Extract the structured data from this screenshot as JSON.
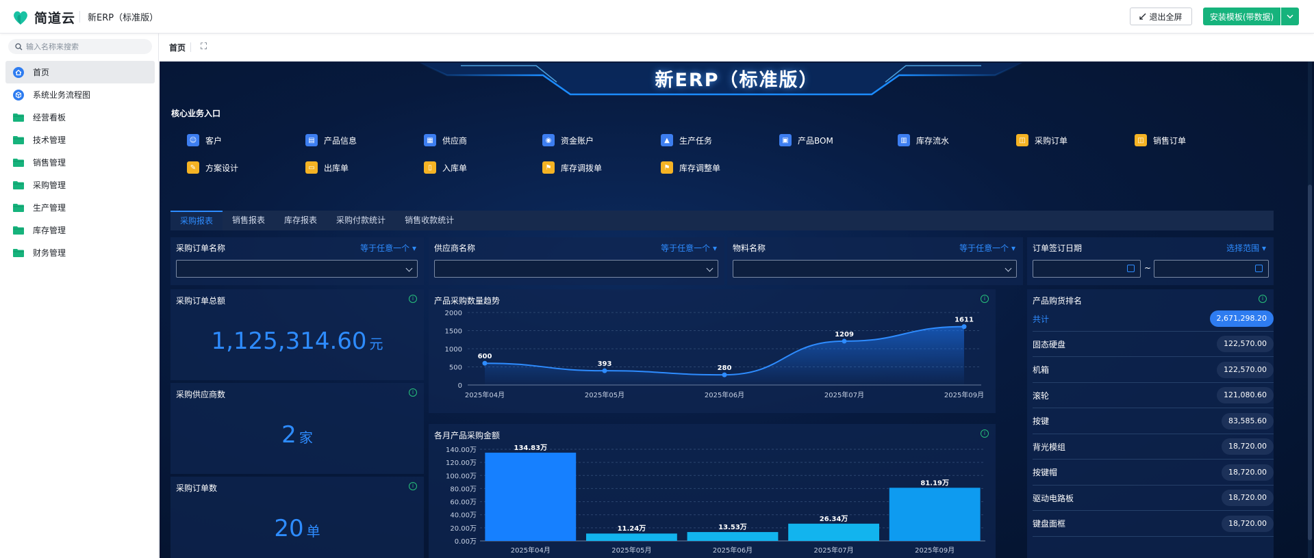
{
  "topbar": {
    "logo_text": "简道云",
    "app_name": "新ERP（标准版）",
    "exit_fullscreen": "退出全屏",
    "install_button": "安装模板(带数据)"
  },
  "sidebar": {
    "search_placeholder": "输入名称来搜索",
    "items": [
      {
        "label": "首页",
        "icon": "home-icon"
      },
      {
        "label": "系统业务流程图",
        "icon": "cube-icon"
      },
      {
        "label": "经营看板",
        "icon": "folder-icon"
      },
      {
        "label": "技术管理",
        "icon": "folder-icon"
      },
      {
        "label": "销售管理",
        "icon": "folder-icon"
      },
      {
        "label": "采购管理",
        "icon": "folder-icon"
      },
      {
        "label": "生产管理",
        "icon": "folder-icon"
      },
      {
        "label": "库存管理",
        "icon": "folder-icon"
      },
      {
        "label": "财务管理",
        "icon": "folder-icon"
      }
    ]
  },
  "tabs": {
    "home": "首页"
  },
  "dashboard": {
    "title": "新ERP（标准版）",
    "entry_section": "核心业务入口",
    "entries": [
      {
        "label": "客户",
        "color": "blue"
      },
      {
        "label": "产品信息",
        "color": "blue"
      },
      {
        "label": "供应商",
        "color": "blue"
      },
      {
        "label": "资金账户",
        "color": "blue"
      },
      {
        "label": "生产任务",
        "color": "blue"
      },
      {
        "label": "产品BOM",
        "color": "blue"
      },
      {
        "label": "库存流水",
        "color": "blue"
      },
      {
        "label": "采购订单",
        "color": "yellow"
      },
      {
        "label": "销售订单",
        "color": "yellow"
      },
      {
        "label": "方案设计",
        "color": "yellow"
      },
      {
        "label": "出库单",
        "color": "yellow"
      },
      {
        "label": "入库单",
        "color": "yellow"
      },
      {
        "label": "库存调拨单",
        "color": "yellow"
      },
      {
        "label": "库存调整单",
        "color": "yellow"
      }
    ],
    "report_tabs": [
      "采购报表",
      "销售报表",
      "库存报表",
      "采购付款统计",
      "销售收款统计"
    ],
    "filters": [
      {
        "label": "采购订单名称",
        "op": "等于任意一个"
      },
      {
        "label": "供应商名称",
        "op": "等于任意一个"
      },
      {
        "label": "物料名称",
        "op": "等于任意一个"
      },
      {
        "label": "订单签订日期",
        "op": "选择范围",
        "range_sep": "~"
      }
    ],
    "kpis": [
      {
        "title": "采购订单总额",
        "value": "1,125,314.60",
        "unit": "元"
      },
      {
        "title": "采购供应商数",
        "value": "2",
        "unit": "家"
      },
      {
        "title": "采购订单数",
        "value": "20",
        "unit": "单"
      }
    ],
    "ranking": {
      "title": "产品购货排名",
      "total_label": "共计",
      "total_value": "2,671,298.20",
      "rows": [
        {
          "name": "固态硬盘",
          "value": "122,570.00"
        },
        {
          "name": "机箱",
          "value": "122,570.00"
        },
        {
          "name": "滚轮",
          "value": "121,080.60"
        },
        {
          "name": "按键",
          "value": "83,585.60"
        },
        {
          "name": "背光模组",
          "value": "18,720.00"
        },
        {
          "name": "按键帽",
          "value": "18,720.00"
        },
        {
          "name": "驱动电路板",
          "value": "18,720.00"
        },
        {
          "name": "键盘面框",
          "value": "18,720.00"
        }
      ]
    },
    "colors": {
      "accent": "#2e8cff",
      "green": "#16b37c",
      "yellow": "#f5b324",
      "bar1": "#1680ff",
      "bar2": "#12b4ee"
    }
  },
  "chart_data": [
    {
      "type": "area",
      "title": "产品采购数量趋势",
      "categories": [
        "2025年04月",
        "2025年05月",
        "2025年06月",
        "2025年07月",
        "2025年09月"
      ],
      "values": [
        600,
        393,
        280,
        1209,
        1611
      ],
      "ylim": [
        0,
        2000
      ],
      "yticks": [
        "2000",
        "1500",
        "1000",
        "500",
        "0"
      ],
      "grid": true
    },
    {
      "type": "bar",
      "title": "各月产品采购金额",
      "categories": [
        "2025年04月",
        "2025年05月",
        "2025年06月",
        "2025年07月",
        "2025年09月"
      ],
      "values": [
        134.83,
        11.24,
        13.53,
        26.34,
        81.19
      ],
      "labels": [
        "134.83万",
        "11.24万",
        "13.53万",
        "26.34万",
        "81.19万"
      ],
      "ylim": [
        0,
        140
      ],
      "yticks": [
        "140.00万",
        "120.00万",
        "100.00万",
        "80.00万",
        "60.00万",
        "40.00万",
        "20.00万",
        "0.00万"
      ],
      "grid": true
    }
  ]
}
